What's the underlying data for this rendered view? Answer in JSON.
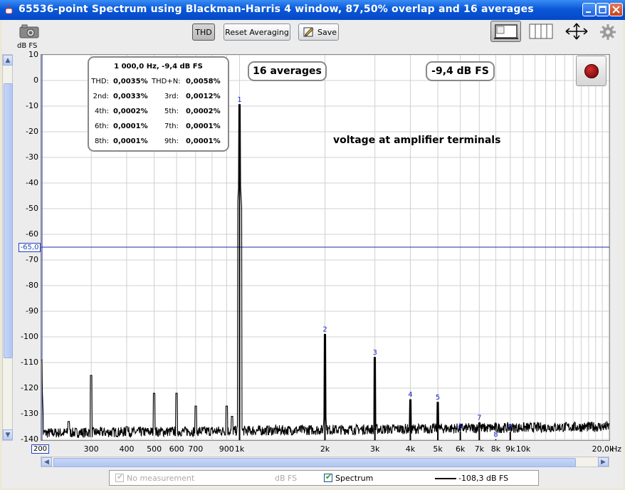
{
  "window": {
    "title": "65536-point Spectrum using Blackman-Harris 4 window, 87,50% overlap and 16 averages"
  },
  "toolbar": {
    "thd_label": "THD",
    "reset_label": "Reset Averaging",
    "save_label": "Save"
  },
  "harmonics_panel": {
    "header": "1 000,0 Hz, -9,4 dB FS",
    "rows": [
      {
        "l1": "THD:",
        "v1": "0,0035%",
        "l2": "THD+N:",
        "v2": "0,0058%"
      },
      {
        "l1": "2nd:",
        "v1": "0,0033%",
        "l2": "3rd:",
        "v2": "0,0012%"
      },
      {
        "l1": "4th:",
        "v1": "0,0002%",
        "l2": "5th:",
        "v2": "0,0002%"
      },
      {
        "l1": "6th:",
        "v1": "0,0001%",
        "l2": "7th:",
        "v2": "0,0001%"
      },
      {
        "l1": "8th:",
        "v1": "0,0001%",
        "l2": "9th:",
        "v2": "0,0001%"
      }
    ]
  },
  "averages_badge": "16 averages",
  "level_badge": "-9,4 dB FS",
  "annotation": "voltage at amplifier terminals",
  "y_axis": {
    "unit_label": "dB FS",
    "cursor_value": "-65,0"
  },
  "x_axis": {
    "cursor_value": "200",
    "unit_label": "Hz"
  },
  "legend": {
    "no_measurement_label": "No measurement",
    "no_measurement_unit": "dB FS",
    "spectrum_label": "Spectrum",
    "spectrum_value": "-108,3 dB FS"
  },
  "chart_data": {
    "type": "line",
    "x_scale": "log",
    "xlim": [
      200,
      20000
    ],
    "ylim": [
      -140,
      10
    ],
    "ylabel": "dB FS",
    "xlabel": "Hz",
    "y_ticks": [
      10,
      0,
      -10,
      -20,
      -30,
      -40,
      -50,
      -60,
      -70,
      -80,
      -90,
      -100,
      -110,
      -120,
      -130,
      -140
    ],
    "y_tick_labels": [
      "10",
      "0",
      "-10",
      "-20",
      "-30",
      "-40",
      "-50",
      "-60",
      "-70",
      "-80",
      "-90",
      "-100",
      "-110",
      "-120",
      "-130",
      "-140"
    ],
    "x_ticks": [
      300,
      400,
      500,
      600,
      700,
      900,
      1000,
      2000,
      3000,
      4000,
      5000,
      6000,
      7000,
      8000,
      9000,
      10000,
      20000
    ],
    "x_tick_labels": [
      "300",
      "400",
      "500",
      "600",
      "700",
      "900",
      "1k",
      "2k",
      "3k",
      "4k",
      "5k",
      "6k",
      "7k",
      "8k",
      "9k",
      "10k",
      "20,0k"
    ],
    "x_minor_grid": [
      800,
      11000,
      12000,
      13000,
      14000,
      15000,
      16000,
      17000,
      18000,
      19000
    ],
    "grid": true,
    "cursor_y": -65,
    "noise_floor": -137.5,
    "harmonics": [
      {
        "label": "1",
        "freq": 1000,
        "level": -9.4
      },
      {
        "label": "2",
        "freq": 2000,
        "level": -99
      },
      {
        "label": "3",
        "freq": 3000,
        "level": -108
      },
      {
        "label": "4",
        "freq": 4000,
        "level": -124.5
      },
      {
        "label": "5",
        "freq": 5000,
        "level": -125.5
      },
      {
        "label": "6",
        "freq": 6000,
        "level": -137
      },
      {
        "label": "7",
        "freq": 7000,
        "level": -133.5
      },
      {
        "label": "8",
        "freq": 8000,
        "level": -140
      },
      {
        "label": "9",
        "freq": 9000,
        "level": -137
      }
    ],
    "other_peaks": [
      {
        "freq": 200,
        "level": -109
      },
      {
        "freq": 300,
        "level": -115
      },
      {
        "freq": 500,
        "level": -122
      },
      {
        "freq": 600,
        "level": -122
      },
      {
        "freq": 700,
        "level": -127
      },
      {
        "freq": 900,
        "level": -127
      },
      {
        "freq": 940,
        "level": -131
      },
      {
        "freq": 400,
        "level": -135
      },
      {
        "freq": 250,
        "level": -133
      }
    ],
    "series_color": "#000000",
    "cursor_color": "#1a28a0",
    "grid_color": "#d0d0d0"
  }
}
